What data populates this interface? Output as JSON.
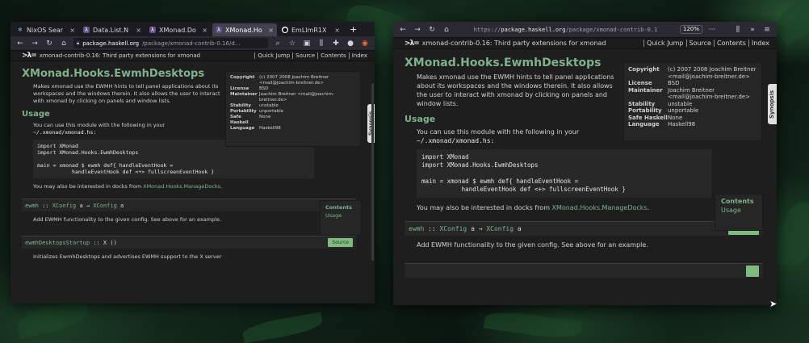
{
  "left_window": {
    "tabs": [
      {
        "label": "NixOS Sear",
        "icon": "nixos-icon",
        "active": false
      },
      {
        "label": "Data.List.N",
        "icon": "haskell-icon",
        "active": false
      },
      {
        "label": "XMonad.Do",
        "icon": "haskell-icon",
        "active": false
      },
      {
        "label": "XMonad.Ho",
        "icon": "haskell-icon",
        "active": true
      },
      {
        "label": "EmLlmR1X",
        "icon": "github-icon",
        "active": false
      }
    ],
    "new_tab": "+",
    "url_host": "package.haskell.org",
    "url_path": "/package/xmonad-contrib-0.16/d...",
    "page": {
      "header_pkg": "xmonad-contrib-0.16: Third party extensions for xmonad",
      "header_links": [
        "Quick Jump",
        "Source",
        "Contents",
        "Index"
      ],
      "title": "XMonad.Hooks.EwmhDesktops",
      "desc": "Makes xmonad use the EWMH hints to tell panel applications about its workspaces and the windows therein. It also allows the user to interact with xmonad by clicking on panels and window lists.",
      "usage_h": "Usage",
      "usage_intro": "You can use this module with the following in your",
      "usage_path": "~/.xmonad/xmonad.hs:",
      "code": "import XMonad\nimport XMonad.Hooks.EwmhDesktops\n\nmain = xmonad $ ewmh def{ handleEventHook =\n           handleEventHook def <+> fullscreenEventHook }",
      "interest_pre": "You may also be interested in ",
      "interest_docks": "docks",
      "interest_mid": " from ",
      "interest_link": "XMonad.Hooks.ManageDocks",
      "interest_end": ".",
      "decl1_fn": "ewmh",
      "decl1_sig_a": " :: ",
      "decl1_ty1": "XConfig",
      "decl1_sig_b": " a → ",
      "decl1_ty2": "XConfig",
      "decl1_sig_c": " a",
      "decl1_desc": "Add EWMH functionality to the given config. See above for an example.",
      "decl2_fn": "ewmhDesktopsStartup",
      "decl2_sig": " :: X ()",
      "decl2_desc": "Initializes EwmhDesktops and advertises EWMH support to the X server",
      "source_label": "Source",
      "meta": [
        {
          "k": "Copyright",
          "v": "(c) 2007 2008 Joachim Breitner <mail@joachim-breitner.de>"
        },
        {
          "k": "License",
          "v": "BSD"
        },
        {
          "k": "Maintainer",
          "v": "Joachim Breitner <mail@joachim-breitner.de>"
        },
        {
          "k": "Stability",
          "v": "unstable"
        },
        {
          "k": "Portability",
          "v": "unportable"
        },
        {
          "k": "Safe Haskell",
          "v": "None"
        },
        {
          "k": "Language",
          "v": "Haskell98"
        }
      ],
      "contents_h": "Contents",
      "contents_item": "Usage",
      "synopsis": "Synopsis"
    }
  },
  "right_window": {
    "url_prefix": "https://",
    "url_host": "package.haskell.org",
    "url_path": "/package/xmonad-contrib-0.1",
    "zoom": "120%",
    "more": "···",
    "page": {
      "header_pkg": "xmonad-contrib-0.16: Third party extensions for xmonad",
      "header_links": [
        "Quick Jump",
        "Source",
        "Contents",
        "Index"
      ],
      "title": "XMonad.Hooks.EwmhDesktops",
      "desc": "Makes xmonad use the EWMH hints to tell panel applications about its workspaces and the windows therein. It also allows the user to interact with xmonad by clicking on panels and window lists.",
      "usage_h": "Usage",
      "usage_intro": "You can use this module with the following in your",
      "usage_path": "~/.xmonad/xmonad.hs:",
      "code": "import XMonad\nimport XMonad.Hooks.EwmhDesktops\n\nmain = xmonad $ ewmh def{ handleEventHook =\n           handleEventHook def <+> fullscreenEventHook }",
      "interest_pre": "You may also be interested in ",
      "interest_docks": "docks",
      "interest_mid": " from ",
      "interest_link": "XMonad.Hooks.ManageDocks",
      "interest_end": ".",
      "decl1_fn": "ewmh",
      "decl1_sig_a": " :: ",
      "decl1_ty1": "XConfig",
      "decl1_sig_b": " a → ",
      "decl1_ty2": "XConfig",
      "decl1_sig_c": " a",
      "decl1_desc": "Add EWMH functionality to the given config. See above for an example.",
      "source_label": "Source",
      "meta": [
        {
          "k": "Copyright",
          "v": "(c) 2007 2008 Joachim Breitner <mail@joachim-breitner.de>"
        },
        {
          "k": "License",
          "v": "BSD"
        },
        {
          "k": "Maintainer",
          "v": "Joachim Breitner <mail@joachim-breitner.de>"
        },
        {
          "k": "Stability",
          "v": "unstable"
        },
        {
          "k": "Portability",
          "v": "unportable"
        },
        {
          "k": "Safe Haskell",
          "v": "None"
        },
        {
          "k": "Language",
          "v": "Haskell98"
        }
      ],
      "contents_h": "Contents",
      "contents_item": "Usage",
      "synopsis": "Synopsis"
    }
  },
  "colors": {
    "accent_green": "#7fb28c",
    "page_bg": "#1e1e1e",
    "source_button": "#7fbc7f",
    "browser_chrome": "#2b2a33"
  }
}
